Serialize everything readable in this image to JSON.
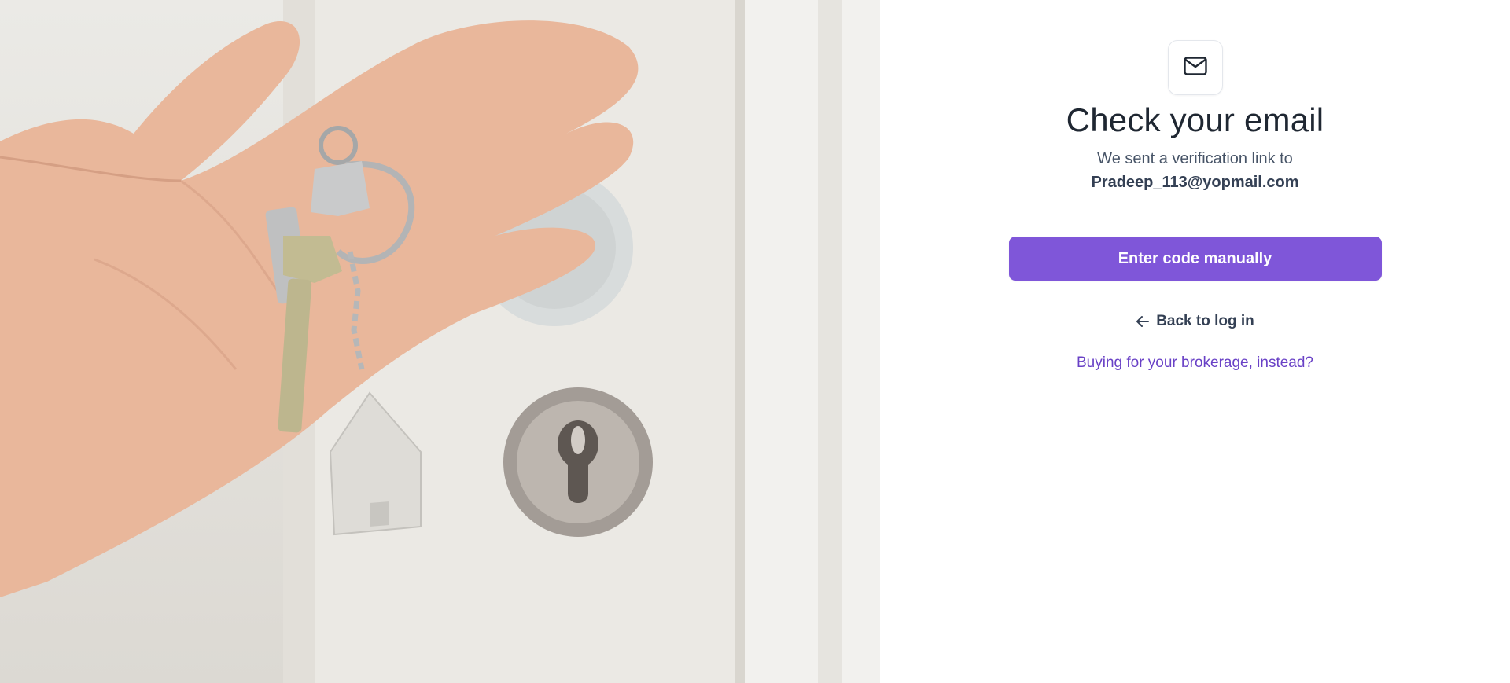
{
  "hero": {
    "image_alt": "Hand holding keys with a house keychain in front of a white door with a lock"
  },
  "icons": {
    "badge_icon": "mail-icon",
    "back_icon": "arrow-left-icon"
  },
  "verification": {
    "title": "Check your email",
    "subtitle": "We sent a verification link to",
    "email": "Pradeep_113@yopmail.com",
    "primary_button": "Enter code manually",
    "back_link": "Back to log in",
    "brokerage_link": "Buying for your brokerage, instead?"
  },
  "colors": {
    "primary": "#7f56d9",
    "link": "#6941c6",
    "heading": "#1f2732",
    "body_text": "#475467"
  }
}
